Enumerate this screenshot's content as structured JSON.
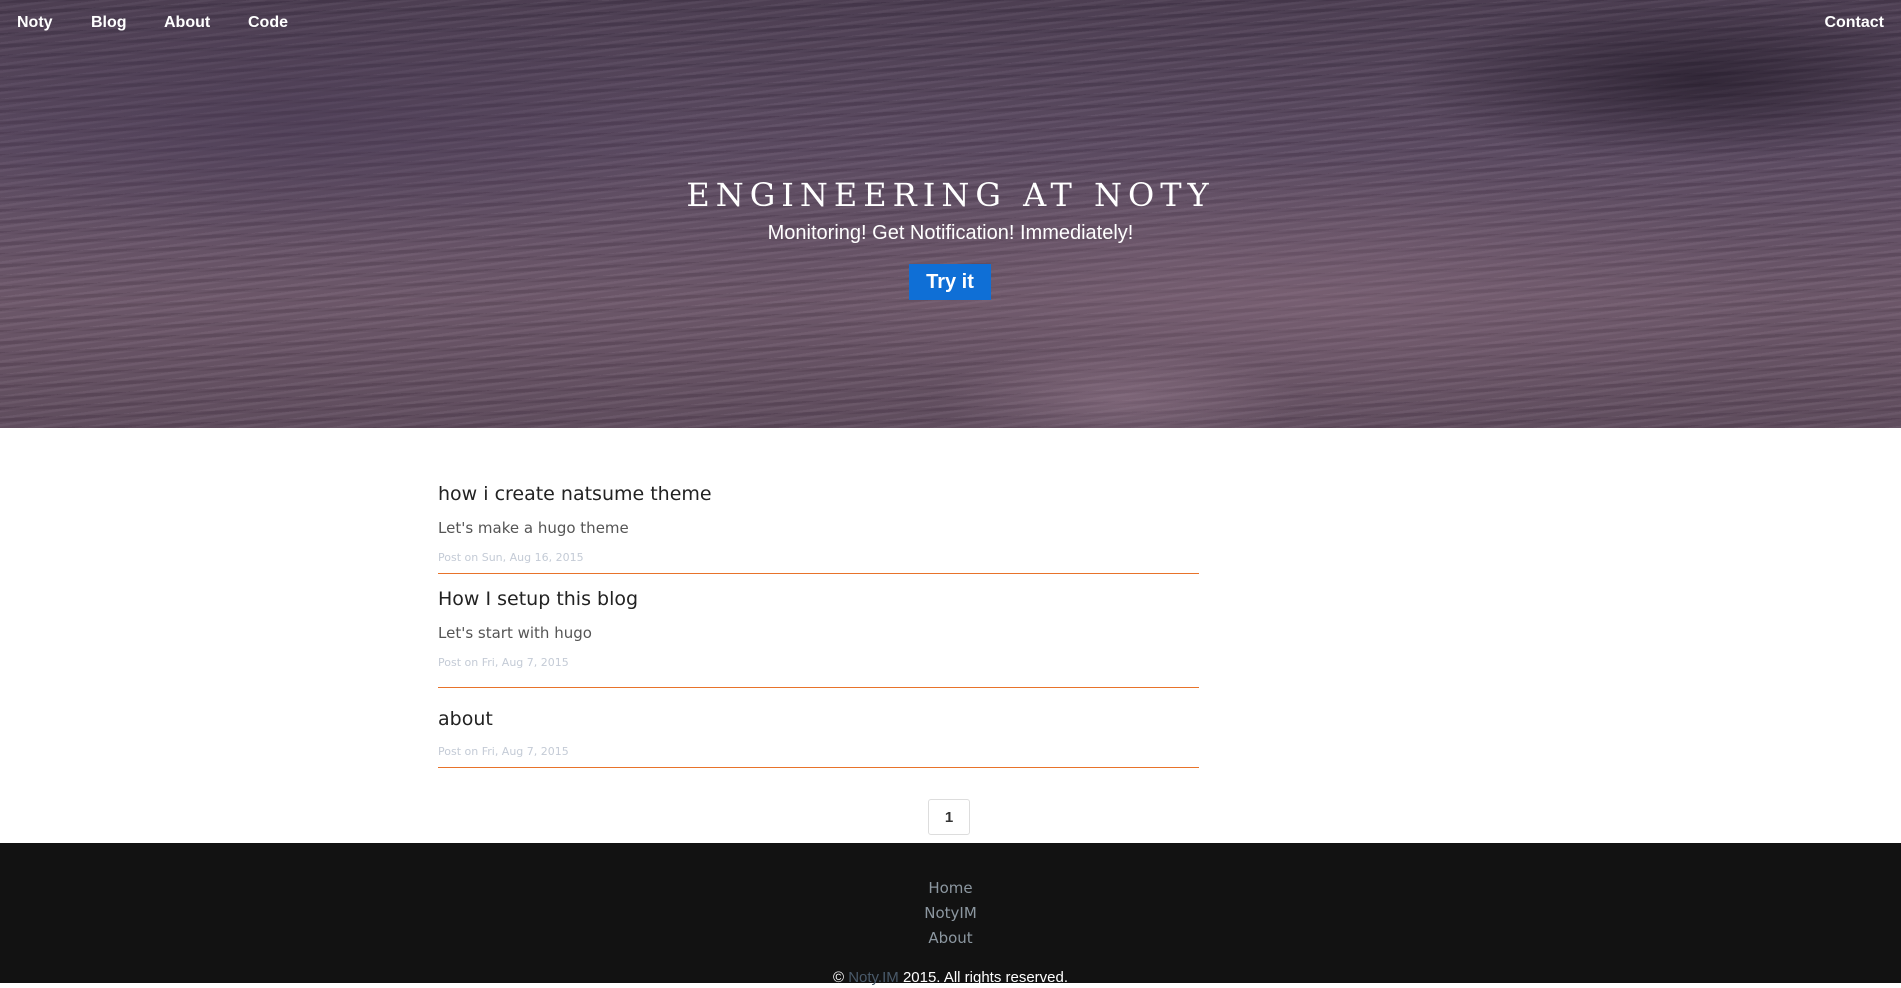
{
  "nav": {
    "brand": "Noty",
    "blog": "Blog",
    "about": "About",
    "code": "Code",
    "contact": "Contact"
  },
  "hero": {
    "title": "Engineering at Noty",
    "subtitle": "Monitoring! Get Notification! Immediately!",
    "cta": "Try it"
  },
  "posts": [
    {
      "title": "how i create natsume theme",
      "summary": "Let's make a hugo theme",
      "date": "Post on Sun, Aug 16, 2015"
    },
    {
      "title": "How I setup this blog",
      "summary": "Let's start with hugo",
      "date": "Post on Fri, Aug 7, 2015"
    },
    {
      "title": "about",
      "summary": "",
      "date": "Post on Fri, Aug 7, 2015"
    }
  ],
  "pagination": {
    "current": "1"
  },
  "footer": {
    "links": [
      "Home",
      "NotyIM",
      "About"
    ],
    "copyright_prefix": "©",
    "copyright_link": "Noty.IM",
    "copyright_suffix": "2015. All rights reserved."
  },
  "colors": {
    "accent": "#0f6fd6",
    "post_divider": "#e8732a",
    "footer_bg": "#121212"
  }
}
